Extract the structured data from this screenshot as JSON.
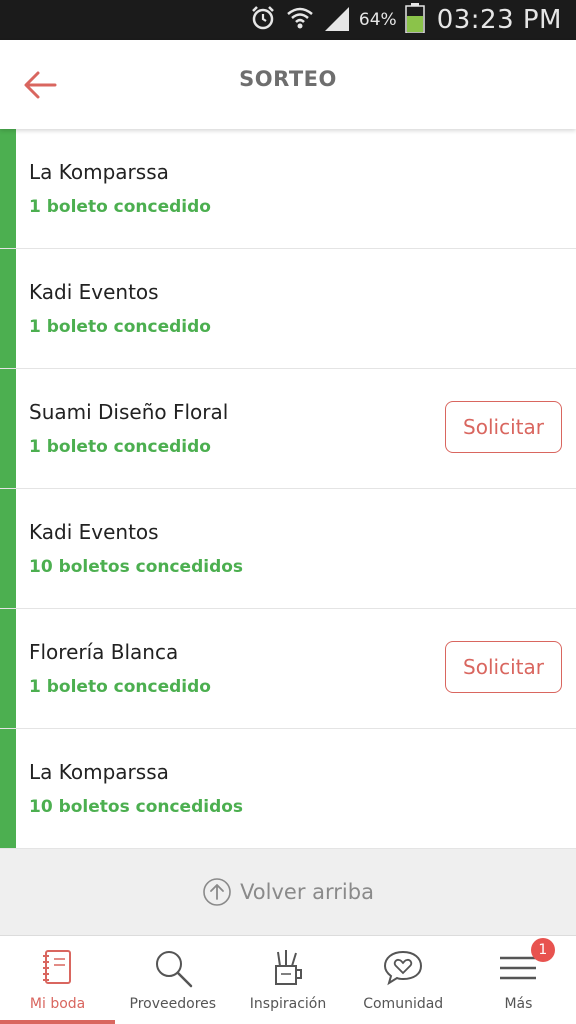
{
  "status_bar": {
    "battery_percent": "64%",
    "time": "03:23 PM"
  },
  "header": {
    "title": "SORTEO"
  },
  "items": [
    {
      "name": "La Komparssa",
      "tickets": "1 boleto concedido",
      "action": ""
    },
    {
      "name": "Kadi Eventos",
      "tickets": "1 boleto concedido",
      "action": ""
    },
    {
      "name": "Suami Diseño Floral",
      "tickets": "1 boleto concedido",
      "action": "Solicitar"
    },
    {
      "name": "Kadi Eventos",
      "tickets": "10 boletos concedidos",
      "action": ""
    },
    {
      "name": "Florería Blanca",
      "tickets": "1 boleto concedido",
      "action": "Solicitar"
    },
    {
      "name": "La Komparssa",
      "tickets": "10 boletos concedidos",
      "action": ""
    }
  ],
  "back_to_top": {
    "label": "Volver arriba"
  },
  "bottom_nav": [
    {
      "label": "Mi boda",
      "icon": "notebook-icon",
      "active": true
    },
    {
      "label": "Proveedores",
      "icon": "search-icon",
      "active": false
    },
    {
      "label": "Inspiración",
      "icon": "pencil-cup-icon",
      "active": false
    },
    {
      "label": "Comunidad",
      "icon": "heart-chat-icon",
      "active": false
    },
    {
      "label": "Más",
      "icon": "menu-icon",
      "active": false,
      "badge": "1"
    }
  ],
  "colors": {
    "accent_green": "#4caf50",
    "brand_coral": "#d9665f",
    "badge_red": "#e8534f"
  }
}
